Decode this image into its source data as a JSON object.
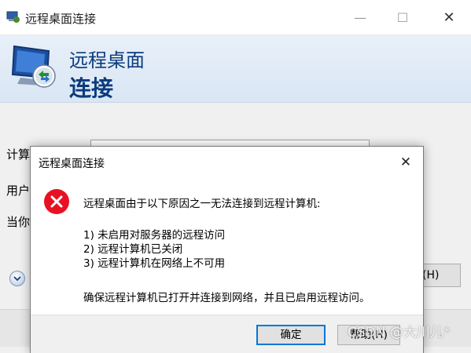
{
  "window": {
    "title": "远程桌面连接",
    "minimize_glyph": "—",
    "maximize_glyph": "☐",
    "close_glyph": "✕"
  },
  "banner": {
    "line1": "远程桌面",
    "line2": "连接"
  },
  "form": {
    "computer_label": "计算",
    "user_label": "用户",
    "note_label": "当你",
    "help_button": "(H)"
  },
  "dialog": {
    "title": "远程桌面连接",
    "close_glyph": "✕",
    "message": "远程桌面由于以下原因之一无法连接到远程计算机:",
    "reasons": [
      "1) 未启用对服务器的远程访问",
      "2) 远程计算机已关闭",
      "3) 远程计算机在网络上不可用"
    ],
    "footer": "确保远程计算机已打开并连接到网络，并且已启用远程访问。",
    "ok_button": "确定",
    "help_button": "帮助(H)"
  },
  "watermark": "CSDN @大川儿*",
  "colors": {
    "banner_text": "#0b3b7d",
    "error_red": "#e81123",
    "focus_border": "#0078d7"
  },
  "icons": {
    "app": "remote-desktop-icon",
    "error": "error-x-icon",
    "options": "chevron-down-icon"
  }
}
